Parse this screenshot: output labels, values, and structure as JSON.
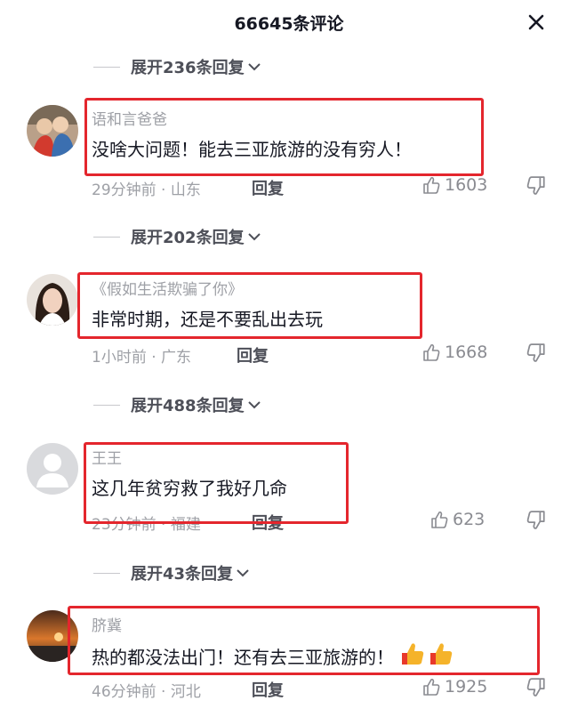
{
  "header": {
    "title": "66645条评论"
  },
  "colors": {
    "highlight": "#e4262d",
    "text": "#161823",
    "muted": "#9ea0a6"
  },
  "expand_rows": [
    {
      "label": "展开236条回复"
    },
    {
      "label": "展开202条回复"
    },
    {
      "label": "展开488条回复"
    },
    {
      "label": "展开43条回复"
    }
  ],
  "comments": [
    {
      "username": "语和言爸爸",
      "content": "没啥大问题！能去三亚旅游的没有穷人！",
      "time_location": "29分钟前 · 山东",
      "reply_label": "回复",
      "likes": "1603"
    },
    {
      "username": "《假如生活欺骗了你》",
      "content": "非常时期，还是不要乱出去玩",
      "time_location": "1小时前 · 广东",
      "reply_label": "回复",
      "likes": "1668"
    },
    {
      "username": "王王",
      "content": "这几年贫穷救了我好几命",
      "time_location": "23分钟前 · 福建",
      "reply_label": "回复",
      "likes": "623"
    },
    {
      "username": "脐冀",
      "content": "热的都没法出门！还有去三亚旅游的！",
      "time_location": "46分钟前 · 河北",
      "reply_label": "回复",
      "likes": "1925",
      "emojis": [
        "thumbs-up-icon",
        "thumbs-up-icon"
      ]
    }
  ]
}
